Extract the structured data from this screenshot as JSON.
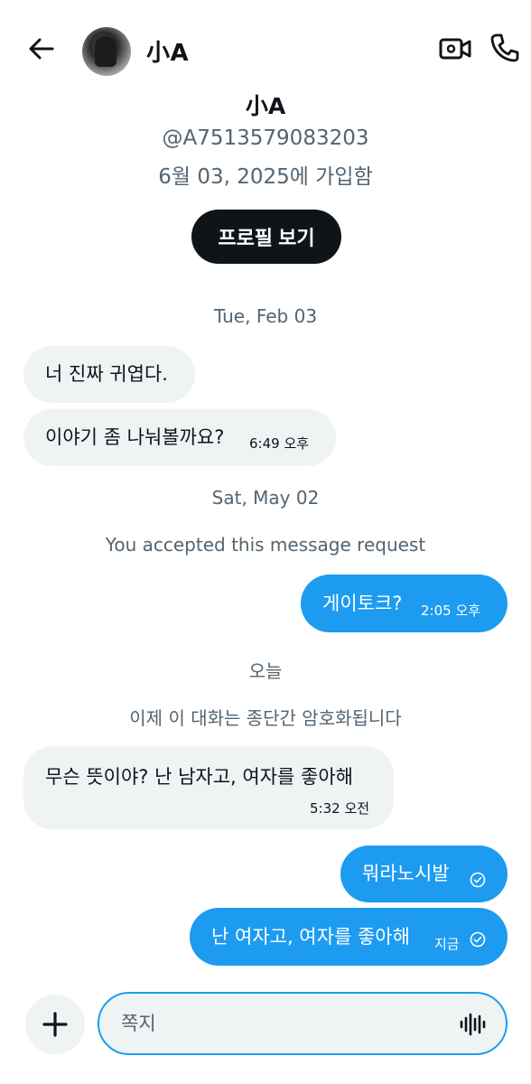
{
  "header": {
    "name": "小A"
  },
  "profile": {
    "name": "小A",
    "handle": "@A7513579083203",
    "joined": "6월 03, 2025에 가입함",
    "view_profile_label": "프로필 보기"
  },
  "system": {
    "date1": "Tue, Feb 03",
    "date2": "Sat, May 02",
    "accepted": "You accepted this message request",
    "today": "오늘",
    "encrypted": "이제 이 대화는 종단간 암호화됩니다"
  },
  "messages": [
    {
      "direction": "in",
      "text": "너 진짜 귀엽다."
    },
    {
      "direction": "in",
      "text": "이야기 좀 나눠볼까요?",
      "time": "6:49 오후"
    },
    {
      "direction": "out",
      "text": "게이토크?",
      "time": "2:05 오후"
    },
    {
      "direction": "in",
      "text": "무슨 뜻이야? 난 남자고, 여자를 좋아해",
      "time": "5:32 오전"
    },
    {
      "direction": "out",
      "text": "뭐라노시발",
      "status": "sent"
    },
    {
      "direction": "out",
      "text": "난 여자고, 여자를 좋아해",
      "time": "지금",
      "status": "sent"
    }
  ],
  "composer": {
    "placeholder": "쪽지"
  },
  "icons": {
    "back": "arrow-left-icon",
    "video": "video-camera-icon",
    "call": "phone-icon",
    "add": "plus-icon",
    "voice": "voice-wave-icon",
    "check": "check-circle-icon"
  },
  "colors": {
    "accent": "#1d9bf0",
    "bubble_in": "#eff3f4",
    "text_secondary": "#536471",
    "primary": "#0f1419"
  }
}
